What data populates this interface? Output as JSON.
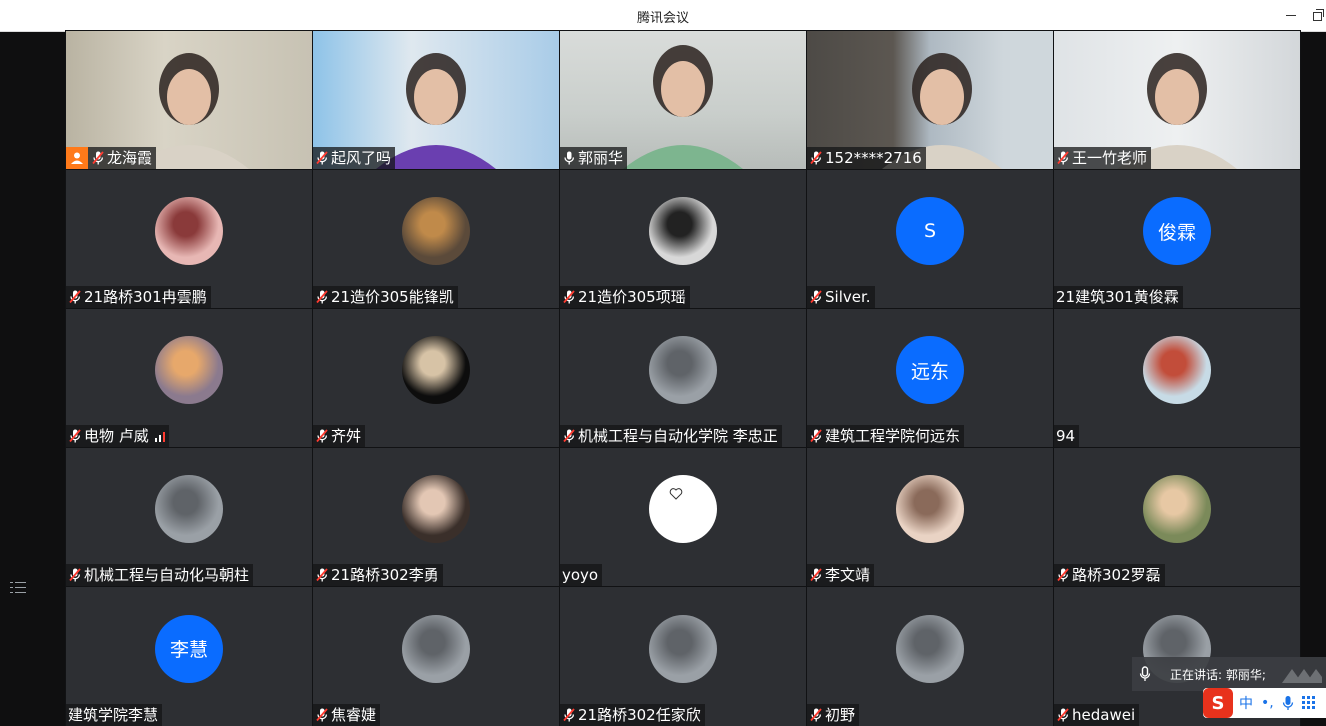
{
  "window": {
    "title": "腾讯会议"
  },
  "participants": [
    {
      "name": "龙海霞",
      "kind": "video",
      "host": true,
      "muted": true
    },
    {
      "name": "起风了吗",
      "kind": "video",
      "muted": true
    },
    {
      "name": "郭丽华",
      "kind": "video",
      "muted": false,
      "active": true
    },
    {
      "name": "152****2716",
      "kind": "video",
      "muted": true
    },
    {
      "name": "王一竹老师",
      "kind": "video",
      "muted": true
    },
    {
      "name": "21路桥301冉雲鹏",
      "kind": "photo",
      "muted": true
    },
    {
      "name": "21造价305能锋凯",
      "kind": "photo",
      "muted": true
    },
    {
      "name": "21造价305项瑶",
      "kind": "photo",
      "muted": true
    },
    {
      "name": "Silver.",
      "kind": "letter",
      "avatar_text": "S",
      "muted": true
    },
    {
      "name": "21建筑301黄俊霖",
      "kind": "letter",
      "avatar_text": "俊霖",
      "muted": false,
      "no_mic": true
    },
    {
      "name": "电物 卢威",
      "kind": "photo",
      "muted": true,
      "signal": true
    },
    {
      "name": "齐舛",
      "kind": "photo",
      "muted": true
    },
    {
      "name": "机械工程与自动化学院 李忠正",
      "kind": "photo",
      "muted": true
    },
    {
      "name": "建筑工程学院何远东",
      "kind": "letter",
      "avatar_text": "远东",
      "muted": true
    },
    {
      "name": "94",
      "kind": "photo",
      "muted": false,
      "no_mic": true
    },
    {
      "name": "机械工程与自动化马朝柱",
      "kind": "photo",
      "muted": true
    },
    {
      "name": "21路桥302李勇",
      "kind": "photo",
      "muted": true
    },
    {
      "name": "yoyo",
      "kind": "heart",
      "muted": false,
      "no_mic": true
    },
    {
      "name": "李文靖",
      "kind": "photo",
      "muted": true
    },
    {
      "name": "路桥302罗磊",
      "kind": "photo",
      "muted": true
    },
    {
      "name": "建筑学院李慧",
      "kind": "letter",
      "avatar_text": "李慧",
      "muted": false,
      "no_mic": true
    },
    {
      "name": "焦睿婕",
      "kind": "photo",
      "muted": true
    },
    {
      "name": "21路桥302任家欣",
      "kind": "photo",
      "muted": true
    },
    {
      "name": "初野",
      "kind": "photo",
      "muted": true
    },
    {
      "name": "hedawei",
      "kind": "photo",
      "muted": true
    }
  ],
  "speaking": {
    "label": "正在讲话: 郭丽华;"
  },
  "ime": {
    "logo": "S",
    "mode": "中",
    "punct": "•,"
  },
  "colors": {
    "accent": "#0a6cff",
    "tile": "#2d2f33",
    "active_border": "#2ecc71",
    "host": "#ff7a1a"
  }
}
